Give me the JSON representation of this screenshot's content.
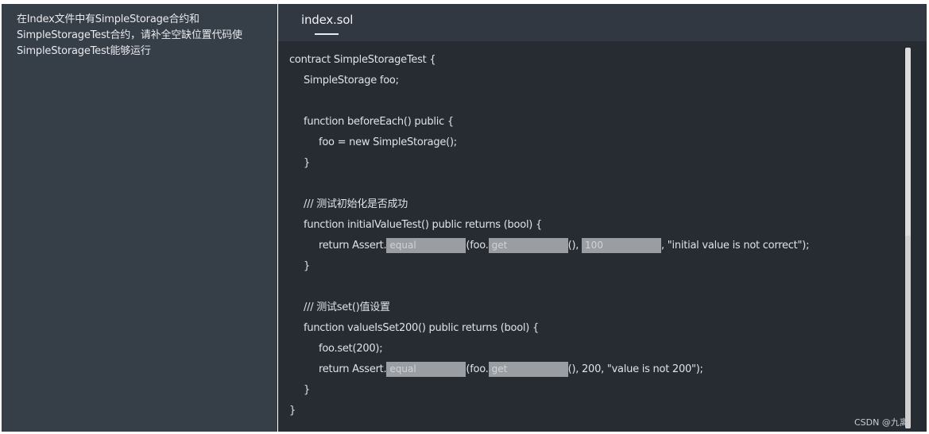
{
  "task": {
    "description": "在Index文件中有SimpleStorage合约和\nSimpleStorageTest合约，请补全空缺位置代码使\nSimpleStorageTest能够运行"
  },
  "editor": {
    "tab_label": "index.sol",
    "lines": [
      "contract SimpleStorageTest {",
      "SimpleStorage foo;",
      "",
      "function beforeEach() public {",
      "foo = new SimpleStorage();",
      "}",
      "",
      "/// 测试初始化是否成功",
      "function initialValueTest() public returns (bool) {",
      "return Assert.",
      "(foo.",
      "(), ",
      ", \"initial value is not correct\");",
      "}",
      "",
      "/// 测试set()值设置",
      "function valueIsSet200() public returns (bool) {",
      "foo.set(200);",
      "return Assert.",
      "(foo.",
      "(), 200, \"value is not 200\");",
      "}",
      "}"
    ],
    "blanks": {
      "blank1": "equal",
      "blank2": "get",
      "blank3": "100",
      "blank4": "equal",
      "blank5": "get"
    }
  },
  "watermark": "CSDN @九离ㅤ"
}
